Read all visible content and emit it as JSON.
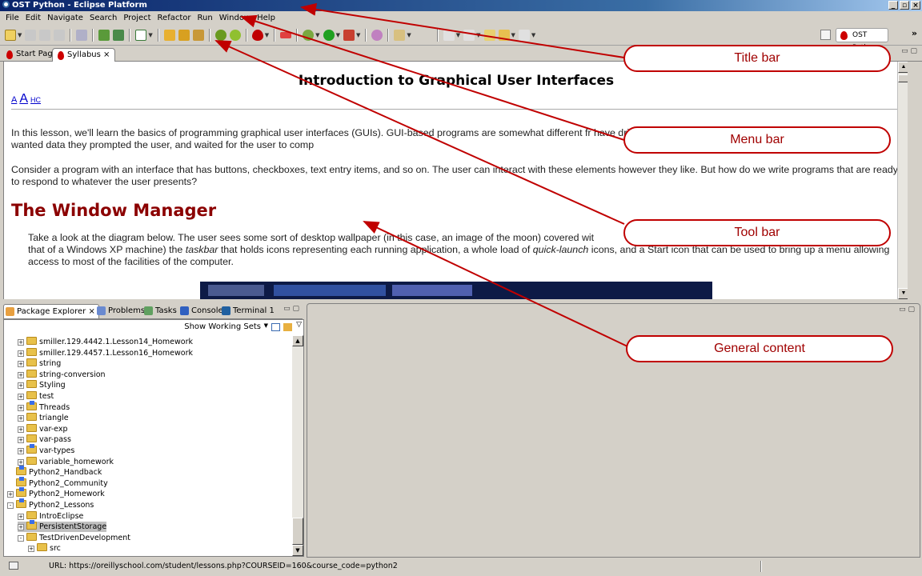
{
  "window": {
    "title": "OST Python - Eclipse Platform",
    "controls": [
      "_",
      "▫",
      "×"
    ]
  },
  "menubar": {
    "items": [
      "File",
      "Edit",
      "Navigate",
      "Search",
      "Project",
      "Refactor",
      "Run",
      "Window",
      "Help"
    ]
  },
  "toolbar": {
    "perspective_label": "OST Python",
    "overflow": "»"
  },
  "editor": {
    "tabs": [
      {
        "label": "Start Page"
      },
      {
        "label": "Syllabus ⨯"
      }
    ],
    "lesson_title": "Introduction to Graphical User Interfaces",
    "font_size_links": [
      "A",
      "A",
      "HC"
    ],
    "para1": "In this lesson, we'll learn the basics of programming graphical user interfaces (GUIs). GUI-based programs are somewhat different fr                                                                                                   have driven the process of user interaction. When the programs wanted data they prompted the user, and waited for the user to comp",
    "para2": "Consider a program with an interface that has buttons, checkboxes, text entry items, and so on. The user can interact with these elements however they like. But how do we write programs that are ready to respond to whatever the user presents?",
    "section_heading": "The Window Manager",
    "para3_a": "Take a look at the diagram below. The user sees some sort of desktop wallpaper (in this case, an image of the moon) covered wit",
    "para3_b": "that of a Windows XP machine) the ",
    "para3_taskbar": "taskbar",
    "para3_c": " that holds icons representing each running application, a whole load of ",
    "para3_quick": "quick-launch",
    "para3_d": " icons, and a Start icon that can be used to bring up a menu allowing access to most of the facilities of the computer."
  },
  "views": {
    "tabs": [
      {
        "label": "Package Explorer ⨯"
      },
      {
        "label": "Problems"
      },
      {
        "label": "Tasks"
      },
      {
        "label": "Console"
      },
      {
        "label": "Terminal 1"
      }
    ],
    "show_working_sets": "Show Working Sets",
    "tree": [
      {
        "label": "smiller.129.4442.1.Lesson14_Homework",
        "exp": "+",
        "indent": 1,
        "proj": false
      },
      {
        "label": "smiller.129.4457.1.Lesson16_Homework",
        "exp": "+",
        "indent": 1,
        "proj": false
      },
      {
        "label": "string",
        "exp": "+",
        "indent": 1,
        "proj": false
      },
      {
        "label": "string-conversion",
        "exp": "+",
        "indent": 1,
        "proj": false
      },
      {
        "label": "Styling",
        "exp": "+",
        "indent": 1,
        "proj": false
      },
      {
        "label": "test",
        "exp": "+",
        "indent": 1,
        "proj": false
      },
      {
        "label": "Threads",
        "exp": "+",
        "indent": 1,
        "proj": true
      },
      {
        "label": "triangle",
        "exp": "+",
        "indent": 1,
        "proj": false
      },
      {
        "label": "var-exp",
        "exp": "+",
        "indent": 1,
        "proj": false
      },
      {
        "label": "var-pass",
        "exp": "+",
        "indent": 1,
        "proj": false
      },
      {
        "label": "var-types",
        "exp": "+",
        "indent": 1,
        "proj": true
      },
      {
        "label": "variable_homework",
        "exp": "+",
        "indent": 1,
        "proj": false
      },
      {
        "label": "Python2_Handback",
        "exp": "",
        "indent": 0,
        "proj": true
      },
      {
        "label": "Python2_Community",
        "exp": "",
        "indent": 0,
        "proj": true
      },
      {
        "label": "Python2_Homework",
        "exp": "+",
        "indent": 0,
        "proj": true
      },
      {
        "label": "Python2_Lessons",
        "exp": "-",
        "indent": 0,
        "proj": true
      },
      {
        "label": "IntroEclipse",
        "exp": "+",
        "indent": 1,
        "proj": false
      },
      {
        "label": "PersistentStorage",
        "exp": "+",
        "indent": 1,
        "proj": true
      },
      {
        "label": "TestDrivenDevelopment",
        "exp": "-",
        "indent": 1,
        "proj": false
      },
      {
        "label": "src",
        "exp": "+",
        "indent": 2,
        "proj": false
      }
    ]
  },
  "statusbar": {
    "url": "URL: https://oreillyschool.com/student/lessons.php?COURSEID=160&course_code=python2"
  },
  "callouts": {
    "title_bar": "Title bar",
    "menu_bar": "Menu bar",
    "tool_bar": "Tool bar",
    "general_content": "General content"
  },
  "colors": {
    "titlebar": "#0a246a",
    "heading": "#8b0000",
    "callout": "#c00000"
  }
}
